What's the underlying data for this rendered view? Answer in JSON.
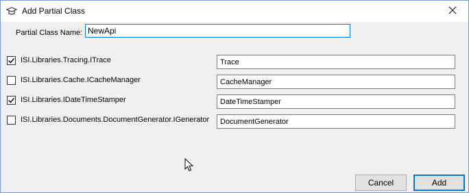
{
  "window": {
    "title": "Add Partial Class"
  },
  "icons": {
    "app": "app-icon",
    "close": "close-icon"
  },
  "form": {
    "name_label": "Partial Class Name:",
    "name_value": "NewApi"
  },
  "rows": [
    {
      "label": "ISI.Libraries.Tracing.ITrace",
      "checked": true,
      "value": "Trace"
    },
    {
      "label": "ISI.Libraries.Cache.ICacheManager",
      "checked": false,
      "value": "CacheManager"
    },
    {
      "label": "ISI.Libraries.IDateTimeStamper",
      "checked": true,
      "value": "DateTimeStamper"
    },
    {
      "label": "ISI.Libraries.Documents.DocumentGenerator.IGenerator",
      "checked": false,
      "value": "DocumentGenerator"
    }
  ],
  "buttons": {
    "cancel_label": "Cancel",
    "add_label": "Add"
  },
  "colors": {
    "accent": "#0078d7",
    "window_bg": "#f0f0f0"
  }
}
